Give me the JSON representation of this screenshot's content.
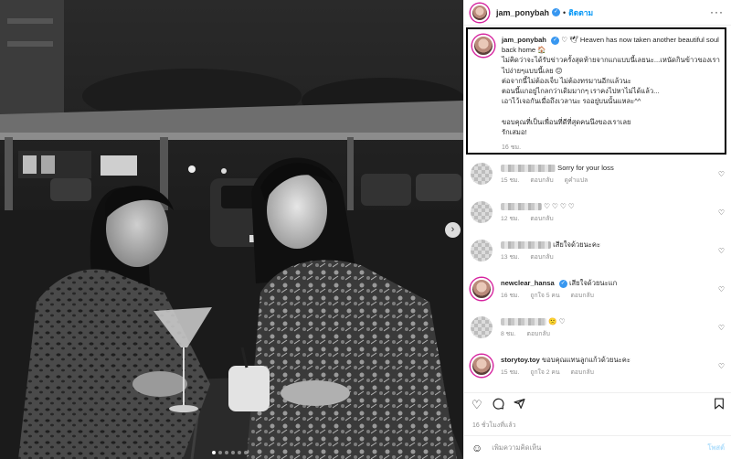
{
  "header": {
    "username": "jam_ponybah",
    "follow_label": "ติดตาม",
    "dot": "•",
    "more": "···"
  },
  "caption": {
    "username": "jam_ponybah",
    "lines": [
      "♡ 🕊 Heaven has now taken another beautiful soul back home 🏠",
      "ไม่คิดว่าจะได้รับข่าวครั้งสุดท้ายจากแกแบบนี้เลยนะ...เหนัดกินข้าวของเราไปง่ายๆแบบนี้เลย 😔",
      "ต่อจากนี้ไม่ต้องเจ็บ ไม่ต้องทรมานอีกแล้วนะ",
      "ตอนนี้แกอยู่ไกลกว่าเดิมมากๆ เราคงไปหาไม่ได้แล้ว...",
      "เอาไว้เจอกันเมื่อถึงเวลานะ รออยู่บนนั้นแหละ^^",
      "",
      "ขอบคุณที่เป็นเพื่อนที่ดีที่สุดคนนึงของเราเลย",
      "รักเสมอ!"
    ],
    "time": "16 ชม."
  },
  "comments": [
    {
      "username": "",
      "text": "Sorry for your loss",
      "time": "15 ชม.",
      "reply": "ตอบกลับ",
      "translate": "ดูคำแปล",
      "likes": ""
    },
    {
      "username": "",
      "text": "♡ ♡ ♡ ♡",
      "time": "12 ชม.",
      "reply": "ตอบกลับ",
      "translate": "",
      "likes": ""
    },
    {
      "username": "",
      "text": "เสียใจด้วยนะคะ",
      "time": "13 ชม.",
      "reply": "ตอบกลับ",
      "translate": "",
      "likes": ""
    },
    {
      "username": "newclear_hansa",
      "text": "เสียใจด้วยนะแก",
      "time": "16 ชม.",
      "reply": "ตอบกลับ",
      "translate": "",
      "likes": "ถูกใจ 5 คน"
    },
    {
      "username": "",
      "text": "🙁 ♡",
      "time": "8 ชม.",
      "reply": "ตอบกลับ",
      "translate": "",
      "likes": ""
    },
    {
      "username": "storytoy.toy",
      "text": "ขอบคุณแทนลูกแก้วด้วยนะคะ",
      "time": "15 ชม.",
      "reply": "ตอบกลับ",
      "translate": "",
      "likes": "ถูกใจ 2 คน"
    },
    {
      "username": "",
      "text": "♥♥♥♥",
      "time": "",
      "reply": "",
      "translate": "",
      "likes": ""
    }
  ],
  "post_time": "16 ชั่วโมงที่แล้ว",
  "add_comment": {
    "placeholder": "เพิ่มความคิดเห็น",
    "post_label": "โพสต์"
  },
  "icons": {
    "like": "heart-icon",
    "comment": "comment-icon",
    "share": "share-icon",
    "save": "bookmark-icon",
    "emoji": "emoji-icon",
    "next": "chevron-right-icon"
  },
  "carousel": {
    "slides": 6,
    "active_slide": 1
  },
  "colors": {
    "link": "#0095f6",
    "verified": "#3897f0",
    "muted": "#8e8e8e"
  }
}
